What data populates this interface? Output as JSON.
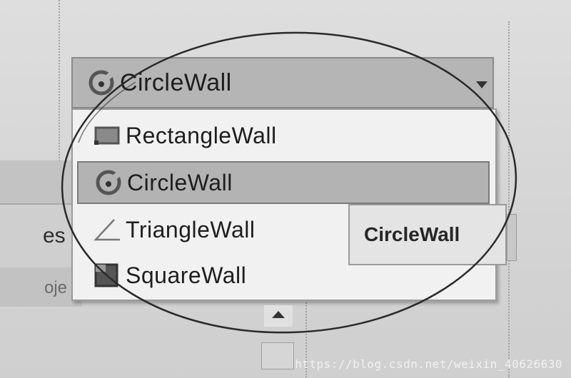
{
  "combo": {
    "selected_label": "CircleWall",
    "selected_icon": "circle-wall-icon"
  },
  "dropdown": {
    "items": [
      {
        "label": "RectangleWall",
        "icon": "rectangle-wall-icon",
        "selected": false
      },
      {
        "label": "CircleWall",
        "icon": "circle-wall-icon",
        "selected": true
      },
      {
        "label": "TriangleWall",
        "icon": "triangle-wall-icon",
        "selected": false
      },
      {
        "label": "SquareWall",
        "icon": "square-wall-icon",
        "selected": false
      }
    ]
  },
  "tooltip": {
    "text": "CircleWall"
  },
  "background": {
    "partial_label_1": "es",
    "partial_label_2": "oje"
  },
  "watermark": "https://blog.csdn.net/weixin_40626630",
  "colors": {
    "selected_row": "#b3b3b3",
    "list_background": "#f1f1f1",
    "annotation_stroke": "#2a2a2a"
  }
}
